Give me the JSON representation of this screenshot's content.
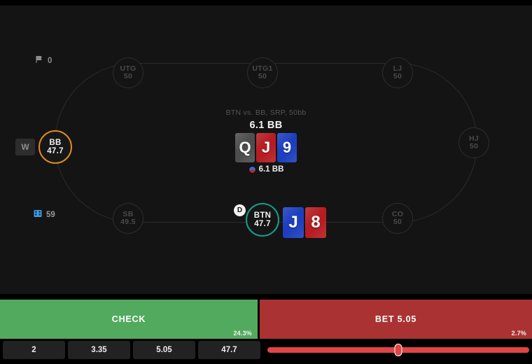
{
  "hud": {
    "flag_icon": "flag-icon",
    "flag_value": "0",
    "film_icon": "film-strip-icon",
    "film_value": "59",
    "w_badge_label": "W"
  },
  "table": {
    "scenario": "BTN vs. BB, SRP, 50bb",
    "pot_top": "6.1 BB",
    "pot_bottom": "6.1 BB",
    "pot_chip_icon": "poker-chip-icon",
    "dealer_button_label": "D",
    "seats": [
      {
        "position": "UTG",
        "stack": "50",
        "state": "folded"
      },
      {
        "position": "UTG1",
        "stack": "50",
        "state": "folded"
      },
      {
        "position": "LJ",
        "stack": "50",
        "state": "folded"
      },
      {
        "position": "HJ",
        "stack": "50",
        "state": "folded"
      },
      {
        "position": "CO",
        "stack": "50",
        "state": "folded"
      },
      {
        "position": "SB",
        "stack": "49.5",
        "state": "folded"
      },
      {
        "position": "BB",
        "stack": "47.7",
        "state": "villain"
      },
      {
        "position": "BTN",
        "stack": "47.7",
        "state": "hero"
      }
    ]
  },
  "board": {
    "cards": [
      {
        "rank": "Q",
        "suit": "s"
      },
      {
        "rank": "J",
        "suit": "h"
      },
      {
        "rank": "9",
        "suit": "d"
      }
    ]
  },
  "hero_hand": {
    "cards": [
      {
        "rank": "J",
        "suit": "d"
      },
      {
        "rank": "8",
        "suit": "h"
      }
    ]
  },
  "actions": [
    {
      "label": "CHECK",
      "frequency": "24.3%",
      "color": "#52aa5e"
    },
    {
      "label": "BET 5.05",
      "frequency": "2.7%",
      "color": "#aa3232"
    }
  ],
  "bet_sizes": [
    {
      "label": "2"
    },
    {
      "label": "3.35"
    },
    {
      "label": "5.05"
    },
    {
      "label": "47.7"
    }
  ],
  "slider": {
    "value_percent": 50,
    "accent": "#e04444"
  },
  "colors": {
    "background": "#141414",
    "hero_ring": "#13a08a",
    "villain_ring": "#e08a1e",
    "check_green": "#52aa5e",
    "bet_red": "#aa3232"
  }
}
